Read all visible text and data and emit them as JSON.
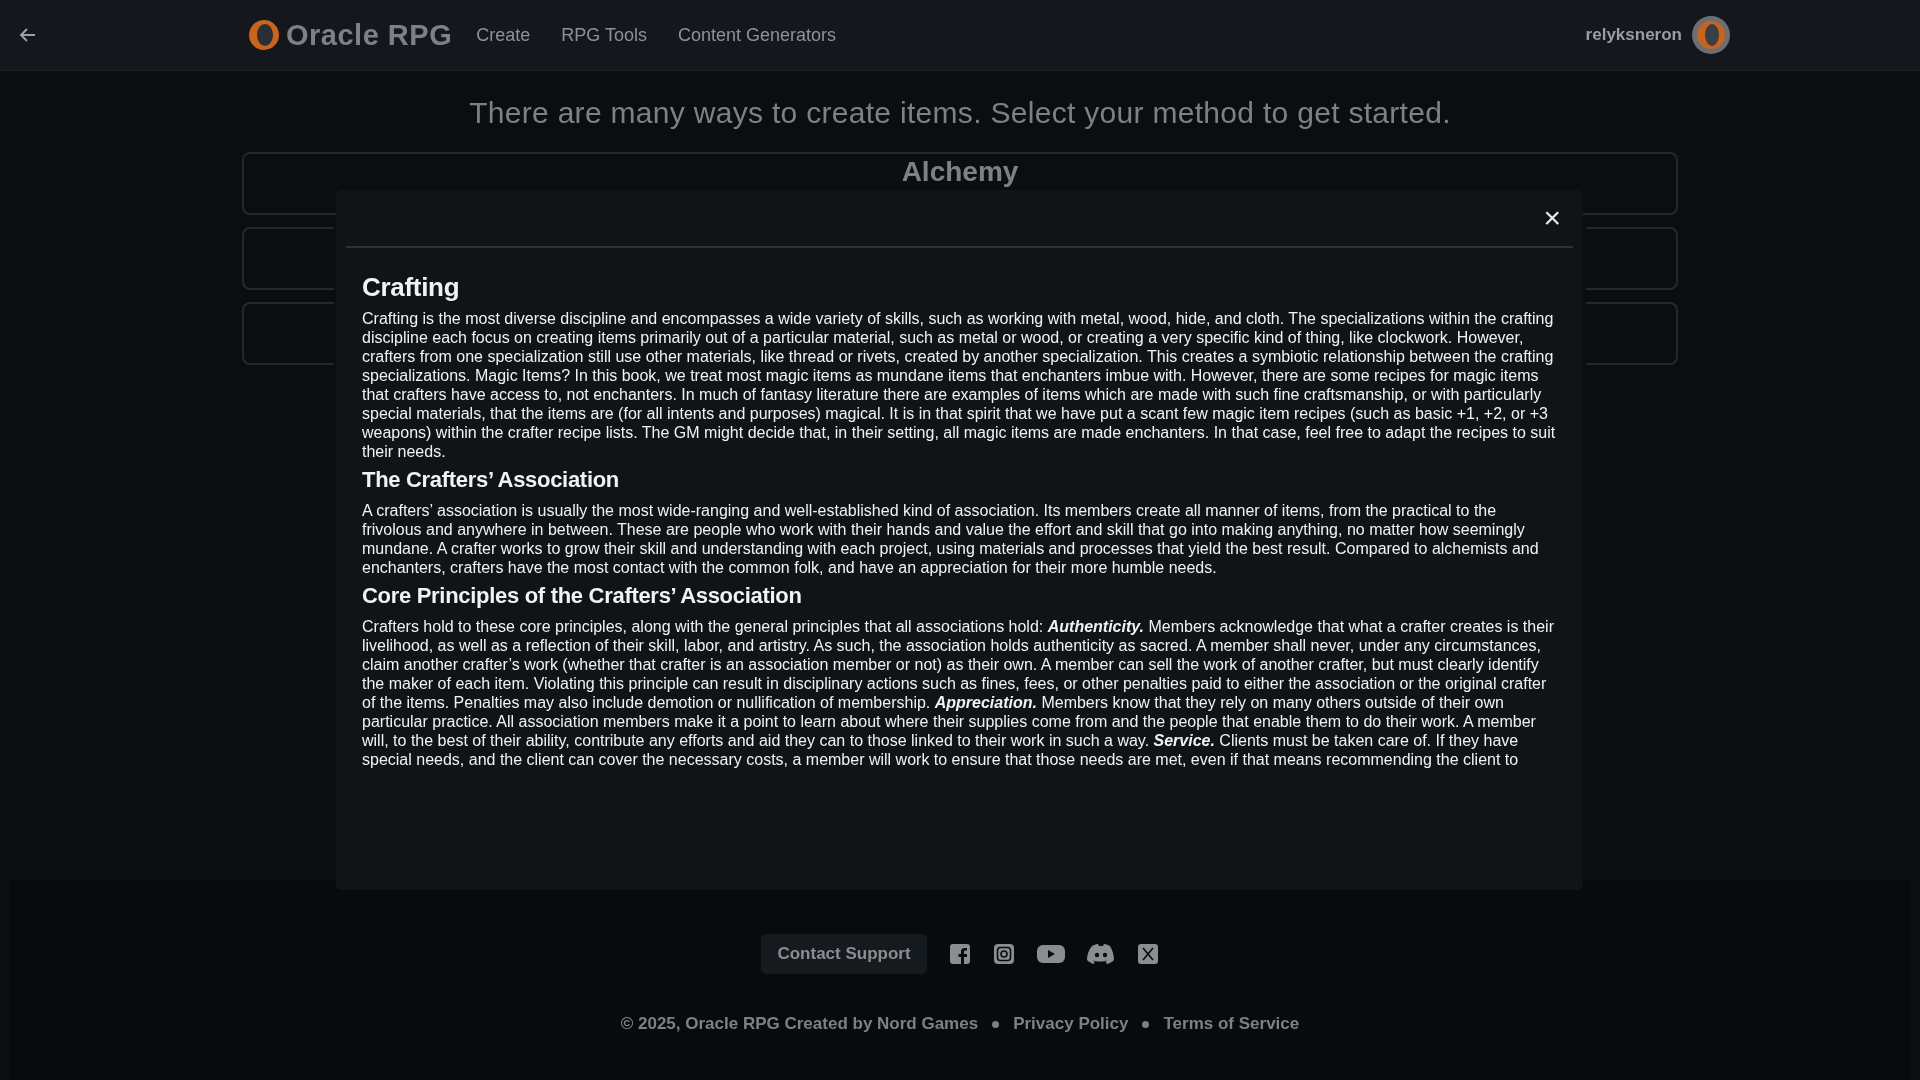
{
  "header": {
    "logo": "Oracle RPG",
    "nav": [
      "Create",
      "RPG Tools",
      "Content Generators"
    ],
    "username": "relyksneron"
  },
  "page": {
    "heading": "There are many ways to create items. Select your method to get started.",
    "method_cards": [
      {
        "kind": "labeled",
        "label": "Alchemy"
      },
      {
        "kind": "covered"
      },
      {
        "kind": "covered"
      }
    ]
  },
  "modal": {
    "close": "×",
    "sections": [
      {
        "title": "Crafting",
        "body": "Crafting is the most diverse discipline and encompasses a wide variety of skills, such as working with metal, wood, hide, and cloth. The specializations within the crafting discipline each focus on creating items primarily out of a particular material, such as metal or wood, or creating a very specific kind of thing, like clockwork. However, crafters from one specialization still use other materials, like thread or rivets, created by another specialization. This creates a symbiotic relationship between the crafting specializations. Magic Items? In this book, we treat most magic items as mundane items that enchanters imbue with. However, there are some recipes for magic items that crafters have access to, not enchanters. In much of fantasy literature there are examples of items which are made with such fine craftsmanship, or with particularly special materials, that the items are (for all intents and purposes) magical. It is in that spirit that we have put a scant few magic item recipes (such as basic +1, +2, or +3 weapons) within the crafter recipe lists. The GM might decide that, in their setting, all magic items are made enchanters. In that case, feel free to adapt the recipes to suit their needs."
      },
      {
        "title": "The Crafters’ Association",
        "body": "A crafters’ association is usually the most wide-ranging and well-established kind of association. Its members create all manner of items, from the practical to the frivolous and anywhere in between. These are people who work with their hands and value the effort and skill that go into making anything, no matter how seemingly mundane. A crafter works to grow their skill and understanding with each project, using materials and processes that yield the best result. Compared to alchemists and enchanters, crafters have the most contact with the common folk, and have an appreciation for their more humble needs."
      },
      {
        "title": "Core Principles of the Crafters’ Association",
        "body": "Crafters hold to these core principles, along with the general principles that all associations hold: **Authenticity.** Members acknowledge that what a crafter creates is their livelihood, as well as a reflection of their skill, labor, and artistry. As such, the association holds authenticity as sacred. A member shall never, under any circumstances, claim another crafter’s work (whether that crafter is an association member or not) as their own. A member can sell the work of another crafter, but must clearly identify the maker of each item. Violating this principle can result in disciplinary actions such as fines, fees, or other penalties paid to either the association or the original crafter of the items. Penalties may also include demotion or nullification of membership. **Appreciation.** Members know that they rely on many others outside of their own particular practice. All association members make it a point to learn about where their supplies come from and the people that enable them to do their work. A member will, to the best of their ability, contribute any efforts and aid they can to those linked to their work in such a way. **Service.** Clients must be taken care of. If they have special needs, and the client can cover the necessary costs, a member will work to ensure that those needs are met, even if that means recommending the client to"
      }
    ]
  },
  "footer": {
    "contact_button": "Contact Support",
    "social": [
      {
        "kind": "facebook"
      },
      {
        "kind": "instagram"
      },
      {
        "kind": "youtube"
      },
      {
        "kind": "discord"
      },
      {
        "kind": "x"
      }
    ],
    "copyright": "© 2025, Oracle RPG Created by Nord Games",
    "links": [
      "Privacy Policy",
      "Terms of Service"
    ]
  }
}
